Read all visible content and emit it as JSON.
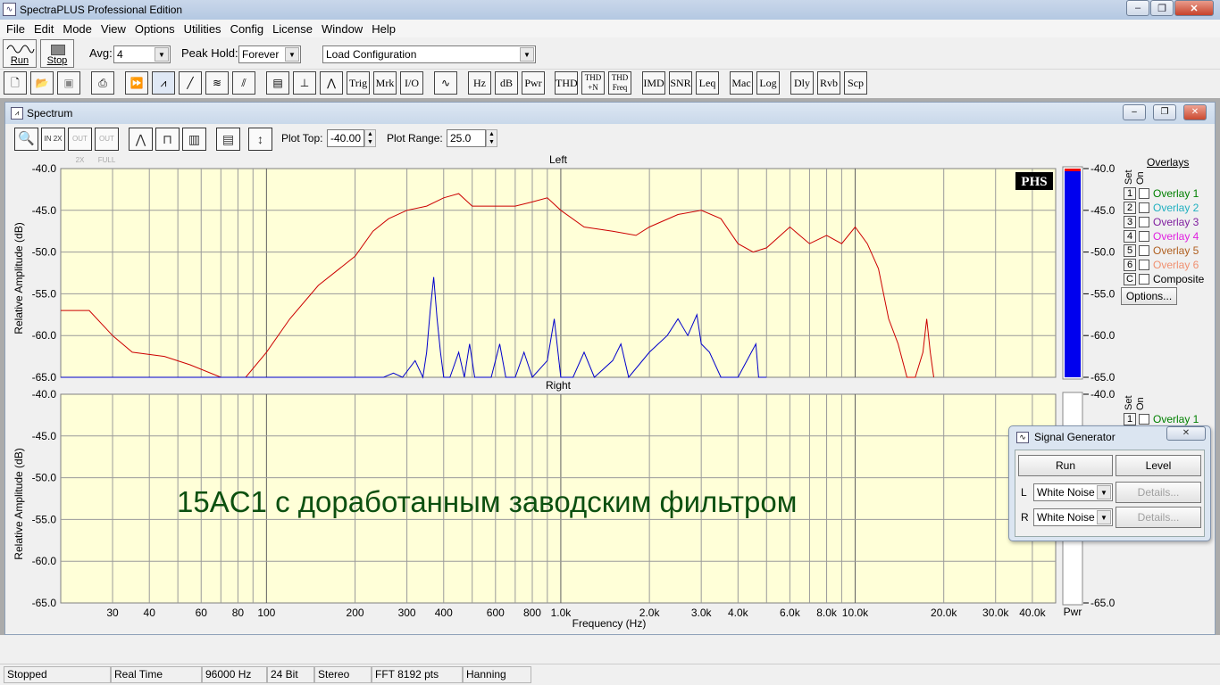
{
  "app": {
    "title": "SpectraPLUS Professional Edition",
    "window_controls": {
      "minimize": "–",
      "restore": "❐",
      "close": "✕"
    }
  },
  "menu": [
    "File",
    "Edit",
    "Mode",
    "View",
    "Options",
    "Utilities",
    "Config",
    "License",
    "Window",
    "Help"
  ],
  "toolbar": {
    "run_label": "Run",
    "stop_label": "Stop",
    "avg_label": "Avg:",
    "avg_value": "4",
    "peakhold_label": "Peak Hold:",
    "peakhold_value": "Forever",
    "config_value": "Load Configuration",
    "text_buttons": [
      "Trig",
      "Mrk",
      "I/O",
      "Hz",
      "dB",
      "Pwr",
      "THD",
      "THD +N",
      "THD Freq",
      "IMD",
      "SNR",
      "Leq",
      "Mac",
      "Log",
      "Dly",
      "Rvb",
      "Scp"
    ]
  },
  "spectrum_window": {
    "title": "Spectrum",
    "plot_top_label": "Plot Top:",
    "plot_top_value": "-40.00",
    "plot_range_label": "Plot Range:",
    "plot_range_value": "25.0",
    "tool_icons": [
      "zoom-icon",
      "zoom-in-2x-icon",
      "zoom-out-2x-icon",
      "zoom-out-full-icon",
      "line-graph-icon",
      "step-graph-icon",
      "bar-graph-icon",
      "data-table-icon",
      "scale-icon"
    ],
    "tool_labels": {
      "in2x": "IN 2X",
      "out2x": "OUT 2X",
      "outfull": "OUT FULL"
    }
  },
  "overlays": {
    "title": "Overlays",
    "set_label": "Set",
    "on_label": "On",
    "items": [
      {
        "btn": "1",
        "name": "Overlay 1",
        "color": "#008000"
      },
      {
        "btn": "2",
        "name": "Overlay 2",
        "color": "#20b0c0"
      },
      {
        "btn": "3",
        "name": "Overlay 3",
        "color": "#8020a0"
      },
      {
        "btn": "4",
        "name": "Overlay 4",
        "color": "#e020e0"
      },
      {
        "btn": "5",
        "name": "Overlay 5",
        "color": "#b06020"
      },
      {
        "btn": "6",
        "name": "Overlay 6",
        "color": "#f09070"
      },
      {
        "btn": "C",
        "name": "Composite",
        "color": "#000000"
      }
    ],
    "options_label": "Options...",
    "right_partial_item": {
      "btn": "1",
      "name": "Overlay 1"
    }
  },
  "annotation_text": "15AC1 с доработанным заводским фильтром",
  "phs_logo": "PHS",
  "meter_label": "Pwr",
  "chart_data": [
    {
      "type": "line",
      "title": "Left",
      "xlabel": "Frequency (Hz)",
      "ylabel": "Relative Amplitude (dB)",
      "x_scale": "log",
      "xlim": [
        20,
        48000
      ],
      "ylim": [
        -65,
        -40
      ],
      "yticks": [
        "-40.0",
        "-45.0",
        "-50.0",
        "-55.0",
        "-60.0",
        "-65.0"
      ],
      "xticks": [
        {
          "v": 30,
          "l": "30"
        },
        {
          "v": 40,
          "l": "40"
        },
        {
          "v": 60,
          "l": "60"
        },
        {
          "v": 80,
          "l": "80"
        },
        {
          "v": 100,
          "l": "100"
        },
        {
          "v": 200,
          "l": "200"
        },
        {
          "v": 300,
          "l": "300"
        },
        {
          "v": 400,
          "l": "400"
        },
        {
          "v": 600,
          "l": "600"
        },
        {
          "v": 800,
          "l": "800"
        },
        {
          "v": 1000,
          "l": "1.0k"
        },
        {
          "v": 2000,
          "l": "2.0k"
        },
        {
          "v": 3000,
          "l": "3.0k"
        },
        {
          "v": 4000,
          "l": "4.0k"
        },
        {
          "v": 6000,
          "l": "6.0k"
        },
        {
          "v": 8000,
          "l": "8.0k"
        },
        {
          "v": 10000,
          "l": "10.0k"
        },
        {
          "v": 20000,
          "l": "20.0k"
        },
        {
          "v": 30000,
          "l": "30.0k"
        },
        {
          "v": 40000,
          "l": "40.0k"
        }
      ],
      "grid": true,
      "series": [
        {
          "color": "#cc0000",
          "points": [
            [
              20,
              -57
            ],
            [
              25,
              -57
            ],
            [
              30,
              -60
            ],
            [
              35,
              -62
            ],
            [
              45,
              -62.5
            ],
            [
              55,
              -63.5
            ],
            [
              70,
              -65
            ],
            [
              85,
              -65
            ],
            [
              100,
              -62
            ],
            [
              120,
              -58
            ],
            [
              150,
              -54
            ],
            [
              200,
              -50.5
            ],
            [
              230,
              -47.5
            ],
            [
              260,
              -46
            ],
            [
              300,
              -45
            ],
            [
              350,
              -44.5
            ],
            [
              400,
              -43.5
            ],
            [
              450,
              -43
            ],
            [
              500,
              -44.5
            ],
            [
              600,
              -44.5
            ],
            [
              700,
              -44.5
            ],
            [
              800,
              -44
            ],
            [
              900,
              -43.5
            ],
            [
              1000,
              -45
            ],
            [
              1200,
              -47
            ],
            [
              1500,
              -47.5
            ],
            [
              1800,
              -48
            ],
            [
              2000,
              -47
            ],
            [
              2500,
              -45.5
            ],
            [
              3000,
              -45
            ],
            [
              3500,
              -46
            ],
            [
              4000,
              -49
            ],
            [
              4500,
              -50
            ],
            [
              5000,
              -49.5
            ],
            [
              6000,
              -47
            ],
            [
              7000,
              -49
            ],
            [
              8000,
              -48
            ],
            [
              9000,
              -49
            ],
            [
              10000,
              -47
            ],
            [
              11000,
              -49
            ],
            [
              12000,
              -52
            ],
            [
              13000,
              -58
            ],
            [
              14000,
              -61
            ],
            [
              15000,
              -65
            ],
            [
              16000,
              -65
            ],
            [
              17000,
              -62
            ],
            [
              17500,
              -58
            ],
            [
              18000,
              -62
            ],
            [
              18500,
              -65
            ]
          ]
        },
        {
          "color": "#0000cc",
          "points": [
            [
              20,
              -65
            ],
            [
              250,
              -65
            ],
            [
              270,
              -64.5
            ],
            [
              290,
              -65
            ],
            [
              320,
              -63
            ],
            [
              340,
              -65
            ],
            [
              350,
              -62
            ],
            [
              360,
              -57
            ],
            [
              370,
              -53
            ],
            [
              380,
              -58
            ],
            [
              390,
              -62
            ],
            [
              400,
              -65
            ],
            [
              420,
              -65
            ],
            [
              450,
              -62
            ],
            [
              470,
              -65
            ],
            [
              490,
              -61
            ],
            [
              510,
              -65
            ],
            [
              580,
              -65
            ],
            [
              620,
              -61
            ],
            [
              650,
              -65
            ],
            [
              700,
              -65
            ],
            [
              750,
              -62
            ],
            [
              800,
              -65
            ],
            [
              900,
              -63
            ],
            [
              950,
              -58
            ],
            [
              1000,
              -65
            ],
            [
              1100,
              -65
            ],
            [
              1200,
              -62
            ],
            [
              1300,
              -65
            ],
            [
              1500,
              -63
            ],
            [
              1600,
              -61
            ],
            [
              1700,
              -65
            ],
            [
              2000,
              -62
            ],
            [
              2300,
              -60
            ],
            [
              2500,
              -58
            ],
            [
              2700,
              -60
            ],
            [
              2900,
              -57.5
            ],
            [
              3000,
              -61
            ],
            [
              3200,
              -62
            ],
            [
              3500,
              -65
            ],
            [
              4000,
              -65
            ],
            [
              4600,
              -61
            ],
            [
              4700,
              -65
            ],
            [
              5000,
              -65
            ]
          ]
        }
      ]
    },
    {
      "type": "line",
      "title": "Right",
      "xlabel": "Frequency (Hz)",
      "ylabel": "Relative Amplitude (dB)",
      "x_scale": "log",
      "xlim": [
        20,
        48000
      ],
      "ylim": [
        -65,
        -40
      ],
      "yticks": [
        "-40.0",
        "-45.0",
        "-50.0",
        "-55.0",
        "-60.0",
        "-65.0"
      ],
      "grid": true,
      "series": []
    }
  ],
  "signal_generator": {
    "title": "Signal Generator",
    "run_label": "Run",
    "level_label": "Level",
    "left_label": "L",
    "right_label": "R",
    "left_value": "White Noise",
    "right_value": "White Noise",
    "details_label": "Details..."
  },
  "status": [
    "Stopped",
    "Real Time",
    "96000 Hz",
    "24 Bit",
    "Stereo",
    "FFT 8192 pts",
    "Hanning"
  ]
}
